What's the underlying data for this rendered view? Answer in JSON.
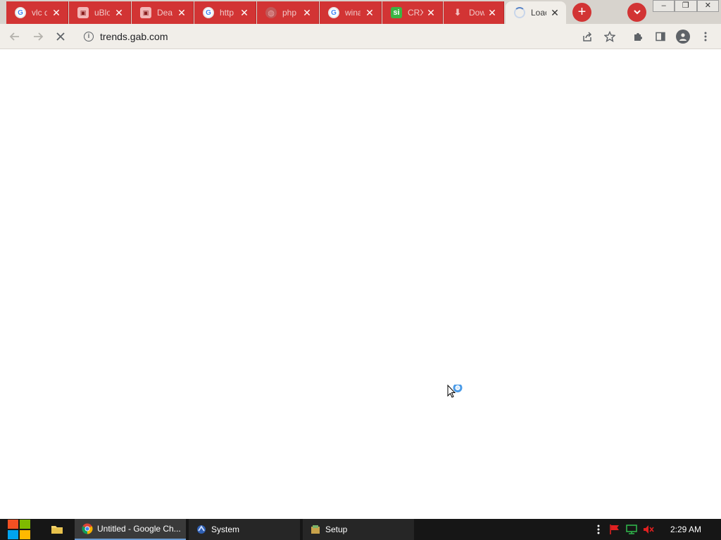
{
  "browser": {
    "tabs": [
      {
        "title": "vlc d",
        "favicon": "google-icon",
        "active": false
      },
      {
        "title": "uBlo",
        "favicon": "ublock-icon",
        "active": false
      },
      {
        "title": "Dea",
        "favicon": "ublock-icon",
        "active": false
      },
      {
        "title": "http",
        "favicon": "google-icon",
        "active": false
      },
      {
        "title": "php",
        "favicon": "globe-icon",
        "active": false
      },
      {
        "title": "wina",
        "favicon": "google-icon",
        "active": false
      },
      {
        "title": "CRX",
        "favicon": "si-icon",
        "active": false
      },
      {
        "title": "Dow",
        "favicon": "download-icon",
        "active": false
      },
      {
        "title": "Loac",
        "favicon": "loading-spinner-icon",
        "active": true
      }
    ],
    "si_favicon_text": "si",
    "close_glyph": "✕",
    "new_tab_glyph": "+",
    "tab_search_glyph": "⌄",
    "address": {
      "url": "trends.gab.com"
    },
    "window_buttons": {
      "minimize": "–",
      "restore": "❐",
      "close": "✕"
    }
  },
  "taskbar": {
    "tasks": [
      {
        "label": "Untitled - Google Ch...",
        "icon": "chrome-icon",
        "active": true
      },
      {
        "label": "System",
        "icon": "system-icon",
        "active": false
      },
      {
        "label": "Setup",
        "icon": "setup-icon",
        "active": false
      }
    ],
    "clock": "2:29 AM"
  },
  "colors": {
    "tab_red": "#d23434",
    "tab_active": "#f1eee9",
    "taskbar": "#161616",
    "accent_blue": "#4a9be8"
  }
}
